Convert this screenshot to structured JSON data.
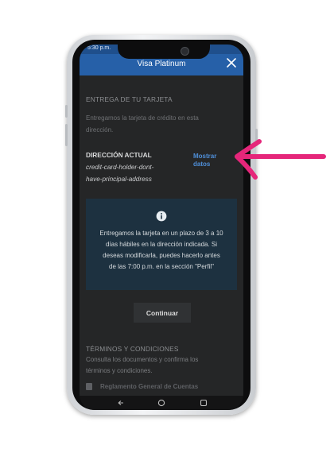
{
  "status_bar": {
    "time": "5:30 p.m."
  },
  "header": {
    "title": "Visa Platinum",
    "close_icon": "close-icon"
  },
  "delivery": {
    "heading": "ENTREGA DE TU TARJETA",
    "description_line1": "Entregamos la tarjeta de crédito en esta",
    "description_line2": "dirección.",
    "current_address_label": "DIRECCIÓN ACTUAL",
    "address_line1": "credit-card-holder-dont-",
    "address_line2": "have-principal-address",
    "show_data_line1": "Mostrar",
    "show_data_line2": "datos"
  },
  "info_notice": {
    "icon": "info-icon",
    "line1": "Entregamos la tarjeta en un plazo de 3 a 10",
    "line2": "días hábiles en la dirección indicada. Si",
    "line3": "deseas modificarla, puedes hacerlo antes",
    "line4": "de las 7:00 p.m. en la sección \"Perfil\""
  },
  "continue_button": {
    "label": "Continuar"
  },
  "terms": {
    "heading": "TÉRMINOS Y CONDICIONES",
    "line1": "Consulta los documentos y confirma los",
    "line2": "términos y condiciones.",
    "first_document": "Reglamento General de Cuentas"
  },
  "annotation": {
    "arrow_color": "#e5267a",
    "icon": "pointer-arrow-icon"
  },
  "colors": {
    "header_blue": "#2660a8",
    "link_blue": "#4f8fd9",
    "screen_bg": "#252627",
    "info_bg": "#1d3140"
  }
}
